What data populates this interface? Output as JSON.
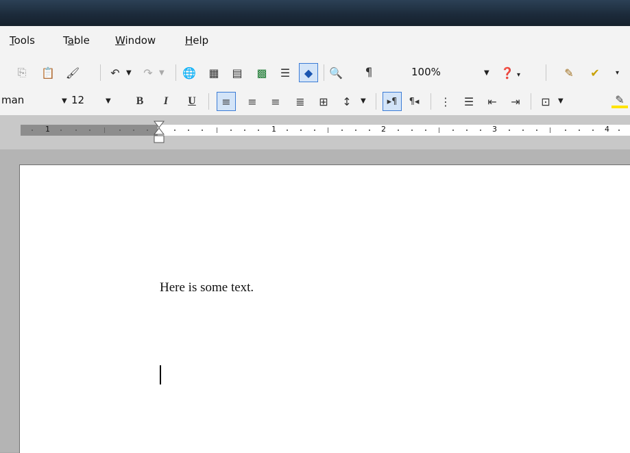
{
  "menu": {
    "tools": "Tools",
    "table": "Table",
    "window": "Window",
    "help": "Help"
  },
  "toolbar": {
    "zoom": "100%",
    "font_name": "man",
    "font_size": "12",
    "bold": "B",
    "italic": "I",
    "underline": "U",
    "pilcrow": "¶"
  },
  "ruler": {
    "labels": [
      "1",
      "1",
      "2",
      "3",
      "4"
    ]
  },
  "document": {
    "text": "Here is some text."
  }
}
